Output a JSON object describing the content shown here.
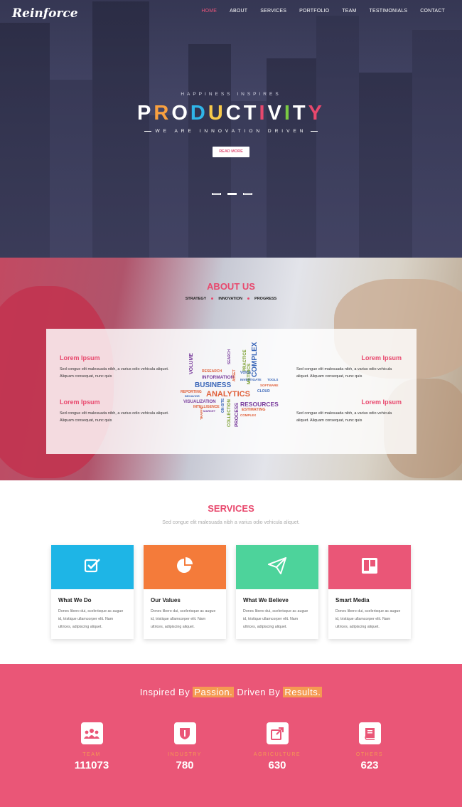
{
  "brand": {
    "logo": "Reinforce"
  },
  "nav": [
    "HOME",
    "ABOUT",
    "SERVICES",
    "PORTFOLIO",
    "TEAM",
    "TESTIMONIALS",
    "CONTACT"
  ],
  "hero": {
    "subtitle": "HAPPINESS INSPIRES",
    "title": "PRODUCTIVITY",
    "title_colors": [
      "#ffffff",
      "#f9a03f",
      "#ffffff",
      "#2fb5e8",
      "#f7c94a",
      "#ffffff",
      "#ffffff",
      "#e8486d",
      "#ffffff",
      "#7ac943",
      "#ffffff",
      "#e8486d"
    ],
    "tagline": "WE ARE INNOVATION DRIVEN",
    "button": "READ MORE"
  },
  "about": {
    "title": "ABOUT US",
    "tags": [
      "STRATEGY",
      "INNOVATION",
      "PROGRESS"
    ],
    "features": [
      {
        "title": "Lorem Ipsum",
        "text": "Sed congue elit malesuada nibh, a varius odio vehicula aliquet. Aliquam consequat, nunc quis"
      },
      {
        "title": "Lorem Ipsum",
        "text": "Sed congue elit malesuada nibh, a varius odio vehicula aliquet. Aliquam consequat, nunc quis"
      },
      {
        "title": "Lorem Ipsum",
        "text": "Sed congue elit malesuada nibh, a varius odio vehicula aliquet. Aliquam consequat, nunc quis"
      },
      {
        "title": "Lorem Ipsum",
        "text": "Sed congue elit malesuada nibh, a varius odio vehicula aliquet. Aliquam consequat, nunc quis"
      }
    ],
    "word_cloud": [
      "VOLUME",
      "RESEARCH",
      "INFORMATION",
      "BUSINESS",
      "ANALYTICS",
      "VISUALIZATION",
      "INTELLIGENCE",
      "REPORTING",
      "BEHAVIOR",
      "TRAFFIC",
      "MARKET",
      "ON-SITE",
      "COLLECTION",
      "PROCESS",
      "RESOURCES",
      "ESTIMATING",
      "COMPLEX",
      "PRACTICE",
      "SEARCH",
      "METRICS",
      "VOICE",
      "INVESTIGATE",
      "TOOLS",
      "SOFTWARE",
      "CLOUD",
      "COMPLEX",
      "ASSET"
    ]
  },
  "services": {
    "title": "SERVICES",
    "subtitle": "Sed congue elit malesuada nibh a varius odio vehicula aliquet.",
    "items": [
      {
        "title": "What We Do",
        "text": "Donec libero dui, scelerisque ac augue id, tristique ullamcorper elit. Nam ultrices, adipiscing aliquet.",
        "color": "#1eb5e6",
        "icon": "checkbox-icon"
      },
      {
        "title": "Our Values",
        "text": "Donec libero dui, scelerisque ac augue id, tristique ullamcorper elit. Nam ultrices, adipiscing aliquet.",
        "color": "#f47b3a",
        "icon": "pie-chart-icon"
      },
      {
        "title": "What We Believe",
        "text": "Donec libero dui, scelerisque ac augue id, tristique ullamcorper elit. Nam ultrices, adipiscing aliquet.",
        "color": "#4dd39b",
        "icon": "paper-plane-icon"
      },
      {
        "title": "Smart Media",
        "text": "Donec libero dui, scelerisque ac augue id, tristique ullamcorper elit. Nam ultrices, adipiscing aliquet.",
        "color": "#ea5677",
        "icon": "trello-icon"
      }
    ]
  },
  "stats": {
    "heading_pre": "Inspired By",
    "heading_hl1": "Passion.",
    "heading_mid": "Driven By",
    "heading_hl2": "Results.",
    "items": [
      {
        "label": "TEAM",
        "value": "111073",
        "icon": "group-icon"
      },
      {
        "label": "INDUSTRY",
        "value": "780",
        "icon": "shield-icon"
      },
      {
        "label": "AGRICULTURE",
        "value": "630",
        "icon": "external-link-icon"
      },
      {
        "label": "OTHERS",
        "value": "623",
        "icon": "book-icon"
      }
    ]
  },
  "colors": {
    "accent": "#e8486d",
    "orange": "#f59a52",
    "stats_bg": "#ea5677"
  }
}
